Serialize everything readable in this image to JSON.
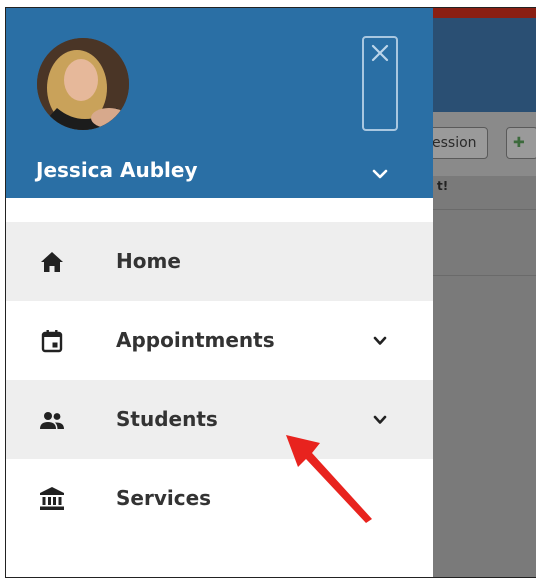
{
  "background_app": {
    "toolbar_button_label": "ession",
    "notice_fragment": "t!"
  },
  "drawer": {
    "user": {
      "name": "Jessica Aubley"
    },
    "close_icon": "close-icon",
    "menu": [
      {
        "label": "Home",
        "icon": "home-icon",
        "has_submenu": false
      },
      {
        "label": "Appointments",
        "icon": "calendar-icon",
        "has_submenu": true
      },
      {
        "label": "Students",
        "icon": "people-icon",
        "has_submenu": true
      },
      {
        "label": "Services",
        "icon": "bank-icon",
        "has_submenu": false
      }
    ]
  },
  "colors": {
    "header_blue": "#2a6fa5",
    "shaded_row": "#eeeeee",
    "annotation_arrow": "#e8231e"
  }
}
